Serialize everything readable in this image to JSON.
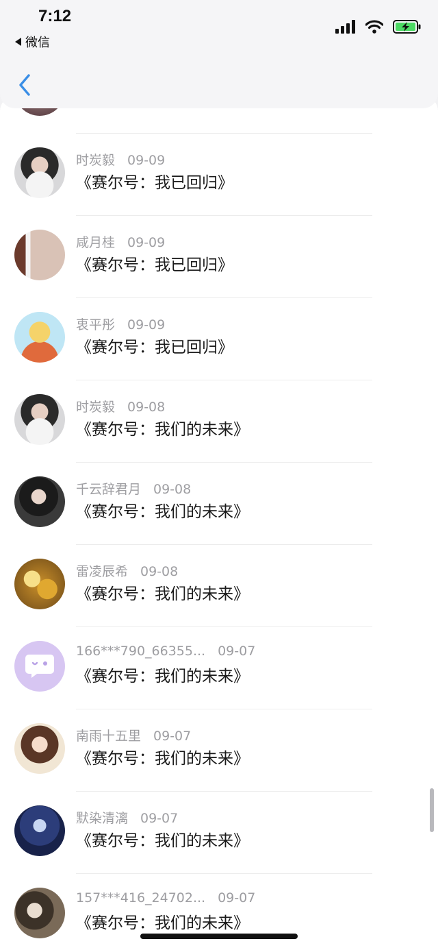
{
  "status_bar": {
    "time": "7:12",
    "back_app": "微信"
  },
  "colors": {
    "accent": "#3a8ee6",
    "meta": "#9e9ea2",
    "text": "#1a1a1a"
  },
  "nav": {
    "back_icon": "chevron-left-icon"
  },
  "comments": [
    {
      "user": "时炭毅",
      "date": "09-09",
      "title": "《赛尔号：我已回归》"
    },
    {
      "user": "咸月桂",
      "date": "09-09",
      "title": "《赛尔号：我已回归》"
    },
    {
      "user": "衷平彤",
      "date": "09-09",
      "title": "《赛尔号：我已回归》"
    },
    {
      "user": "时炭毅",
      "date": "09-08",
      "title": "《赛尔号：我们的未来》"
    },
    {
      "user": "千云辞君月",
      "date": "09-08",
      "title": "《赛尔号：我们的未来》"
    },
    {
      "user": "雷凌辰希",
      "date": "09-08",
      "title": "《赛尔号：我们的未来》"
    },
    {
      "user": "166***790_66355...",
      "date": "09-07",
      "title": "《赛尔号：我们的未来》"
    },
    {
      "user": "南雨十五里",
      "date": "09-07",
      "title": "《赛尔号：我们的未来》"
    },
    {
      "user": "默染清漓",
      "date": "09-07",
      "title": "《赛尔号：我们的未来》"
    },
    {
      "user": "157***416_24702...",
      "date": "09-07",
      "title": "《赛尔号：我们的未来》"
    }
  ]
}
